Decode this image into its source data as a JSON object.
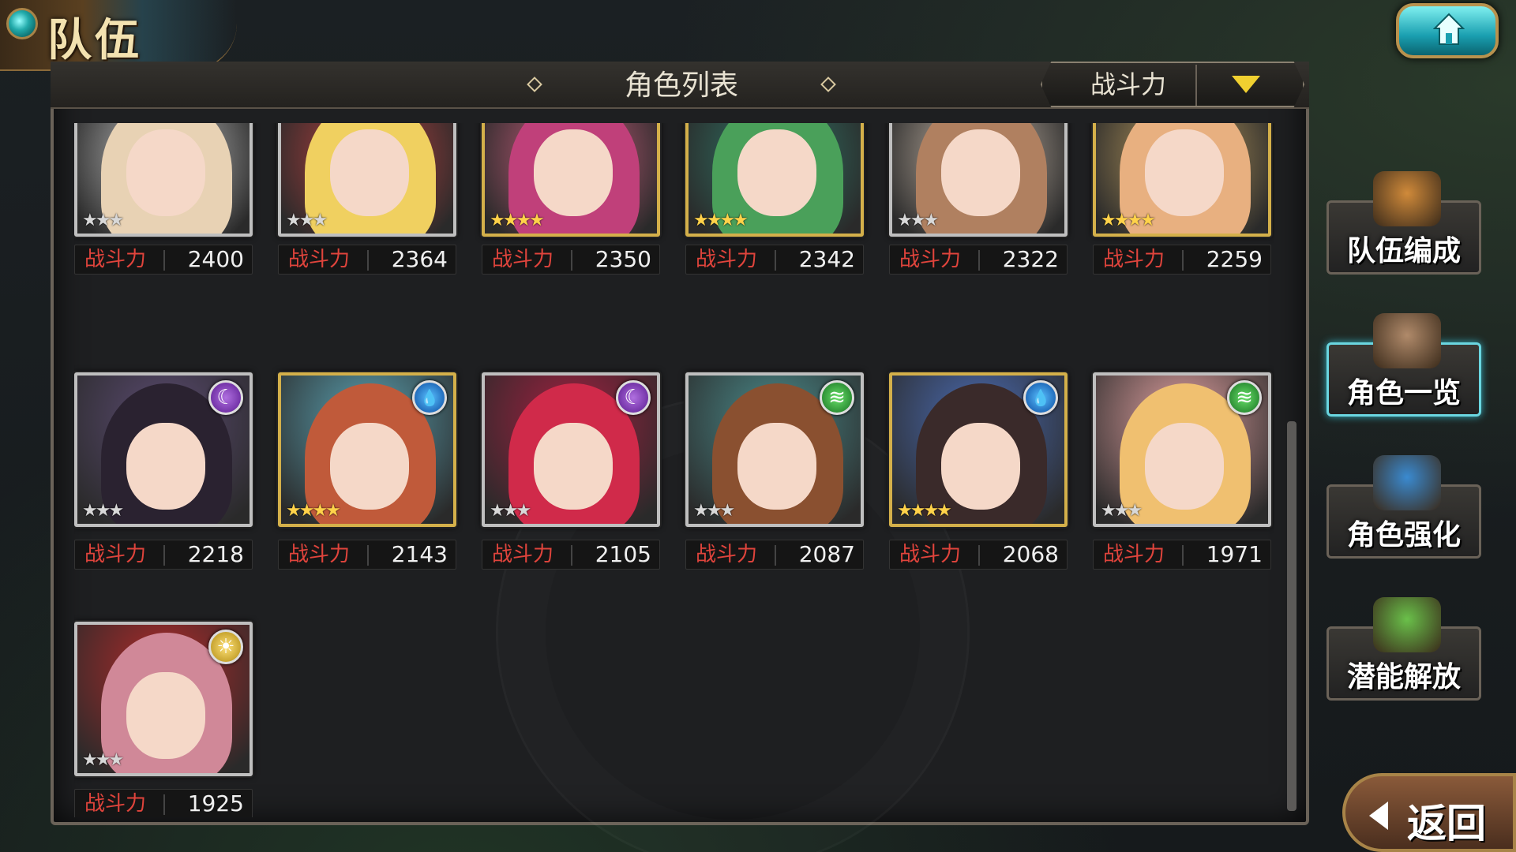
{
  "header": {
    "title": "队伍"
  },
  "panel": {
    "list_title": "角色列表",
    "sort": {
      "selected": "战斗力"
    }
  },
  "characters": [
    {
      "power_label": "战斗力",
      "power": "2400",
      "stars": 3,
      "rarity": "silver",
      "element": null,
      "hair": "#e8d2b4",
      "bg": "#c8c8c8"
    },
    {
      "power_label": "战斗力",
      "power": "2364",
      "stars": 3,
      "rarity": "silver",
      "element": null,
      "hair": "#f0d060",
      "bg": "#c04040"
    },
    {
      "power_label": "战斗力",
      "power": "2350",
      "stars": 4,
      "rarity": "gold",
      "element": null,
      "hair": "#c0407a",
      "bg": "#d06080"
    },
    {
      "power_label": "战斗力",
      "power": "2342",
      "stars": 4,
      "rarity": "gold",
      "element": null,
      "hair": "#4aa05a",
      "bg": "#2f7a6a"
    },
    {
      "power_label": "战斗力",
      "power": "2322",
      "stars": 3,
      "rarity": "silver",
      "element": null,
      "hair": "#b08060",
      "bg": "#d0c0b0"
    },
    {
      "power_label": "战斗力",
      "power": "2259",
      "stars": 4,
      "rarity": "gold",
      "element": null,
      "hair": "#e8b080",
      "bg": "#c0a060"
    },
    {
      "power_label": "战斗力",
      "power": "2218",
      "stars": 3,
      "rarity": "silver",
      "element": "dark",
      "hair": "#2a2230",
      "bg": "#5a4a70"
    },
    {
      "power_label": "战斗力",
      "power": "2143",
      "stars": 4,
      "rarity": "gold",
      "element": "water",
      "hair": "#c05a3a",
      "bg": "#5aa0b0"
    },
    {
      "power_label": "战斗力",
      "power": "2105",
      "stars": 3,
      "rarity": "silver",
      "element": "dark",
      "hair": "#d02a4a",
      "bg": "#a02040"
    },
    {
      "power_label": "战斗力",
      "power": "2087",
      "stars": 3,
      "rarity": "silver",
      "element": "wind",
      "hair": "#8a5030",
      "bg": "#4a8a8a"
    },
    {
      "power_label": "战斗力",
      "power": "2068",
      "stars": 4,
      "rarity": "gold",
      "element": "water",
      "hair": "#3a2a2a",
      "bg": "#4a6ab0"
    },
    {
      "power_label": "战斗力",
      "power": "1971",
      "stars": 3,
      "rarity": "silver",
      "element": "wind",
      "hair": "#f0c070",
      "bg": "#e0a0a0"
    },
    {
      "power_label": "战斗力",
      "power": "1925",
      "stars": 3,
      "rarity": "silver",
      "element": "light",
      "hair": "#d08898",
      "bg": "#b02a2a"
    }
  ],
  "side_menu": [
    {
      "label": "队伍编成",
      "active": false,
      "color": "#d08a3a"
    },
    {
      "label": "角色一览",
      "active": true,
      "color": "#b08a6a"
    },
    {
      "label": "角色强化",
      "active": false,
      "color": "#3a8ad0"
    },
    {
      "label": "潜能解放",
      "active": false,
      "color": "#6ac04a"
    }
  ],
  "back_button": {
    "label": "返回"
  },
  "colors": {
    "power_label": "#e0443c",
    "gold_frame": "#d4b04a",
    "active_side": "#6ad6e0"
  }
}
